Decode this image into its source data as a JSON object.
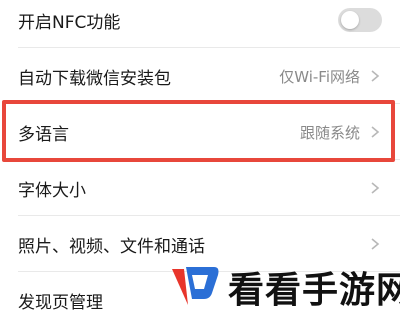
{
  "settings": {
    "nfc": {
      "label": "开启NFC功能",
      "enabled": false
    },
    "auto_download": {
      "label": "自动下载微信安装包",
      "value": "仅Wi-Fi网络"
    },
    "language": {
      "label": "多语言",
      "value": "跟随系统",
      "highlighted": true
    },
    "font_size": {
      "label": "字体大小"
    },
    "media": {
      "label": "照片、视频、文件和通话"
    },
    "discover": {
      "label": "发现页管理"
    }
  },
  "watermark": {
    "text": "看看手游网"
  },
  "colors": {
    "highlight_border": "#e8473b",
    "logo_red": "#e8352b",
    "logo_blue": "#2b6fd6",
    "toggle_off": "#dcdcdc"
  },
  "icons": [
    "chevron-right-icon",
    "toggle-switch",
    "kankan-logo"
  ]
}
